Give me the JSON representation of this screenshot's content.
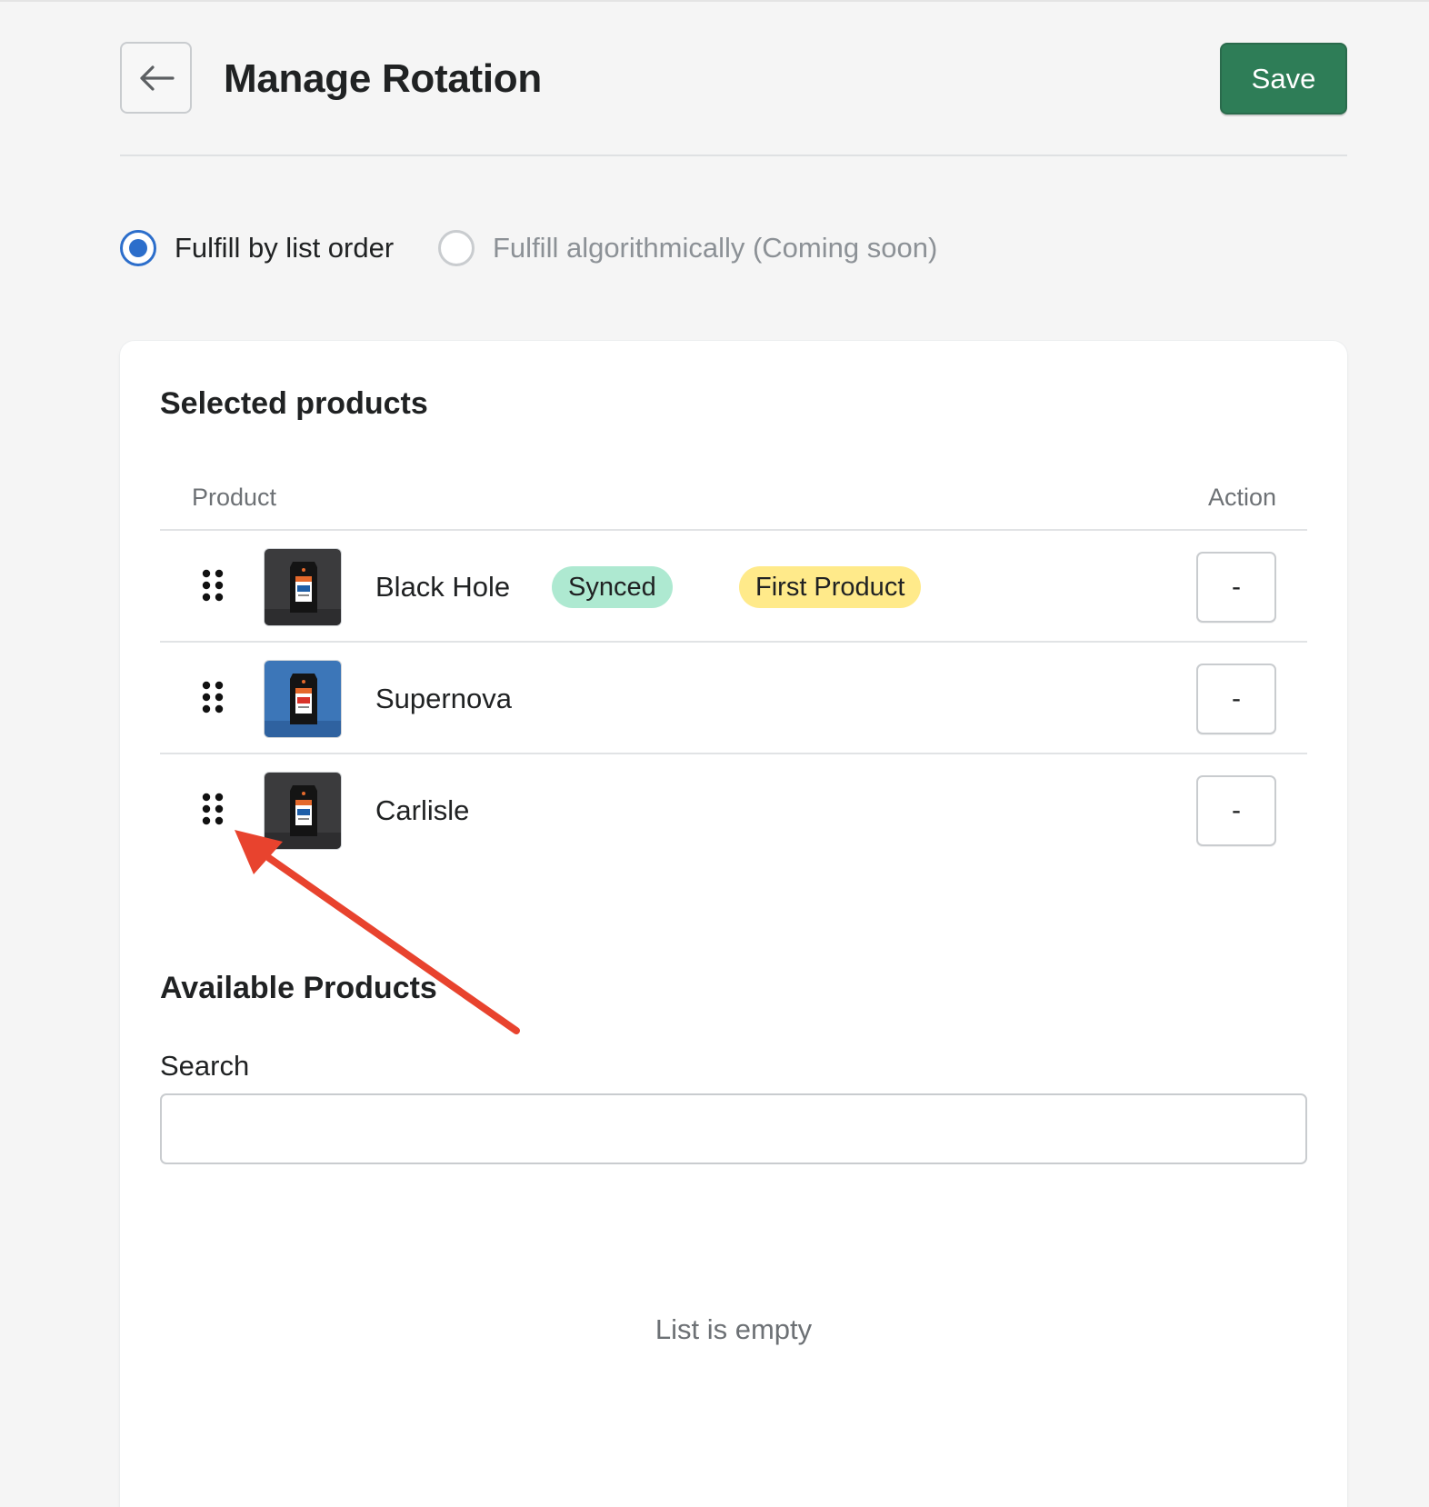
{
  "header": {
    "back_icon": "arrow-left-icon",
    "title": "Manage Rotation",
    "save_label": "Save",
    "save_color": "#2e7d57"
  },
  "fulfillment": {
    "options": [
      {
        "label": "Fulfill by list order",
        "checked": true,
        "disabled": false
      },
      {
        "label": "Fulfill algorithmically (Coming soon)",
        "checked": false,
        "disabled": true
      }
    ],
    "accent_color": "#2c6ecb"
  },
  "selected_products": {
    "title": "Selected products",
    "columns": {
      "product": "Product",
      "action": "Action"
    },
    "rows": [
      {
        "name": "Black Hole",
        "badges": [
          "Synced",
          "First Product"
        ],
        "thumb": "dark",
        "remove_label": "-"
      },
      {
        "name": "Supernova",
        "badges": [],
        "thumb": "blue",
        "remove_label": "-"
      },
      {
        "name": "Carlisle",
        "badges": [],
        "thumb": "dark",
        "remove_label": "-"
      }
    ],
    "badge_colors": {
      "synced": "#aee9d1",
      "first_product": "#ffea8a"
    }
  },
  "available_products": {
    "title": "Available Products",
    "search_label": "Search",
    "search_value": "",
    "search_placeholder": "",
    "empty_text": "List is empty"
  },
  "annotation": {
    "arrow_color": "#e8432e",
    "points_to": "drag-handle"
  }
}
